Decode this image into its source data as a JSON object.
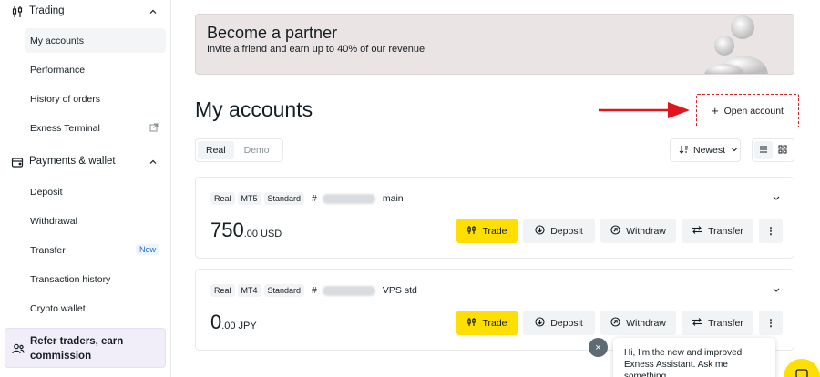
{
  "sidebar": {
    "trading": {
      "label": "Trading",
      "items": [
        {
          "label": "My accounts"
        },
        {
          "label": "Performance"
        },
        {
          "label": "History of orders"
        },
        {
          "label": "Exness Terminal"
        }
      ]
    },
    "payments": {
      "label": "Payments & wallet",
      "items": [
        {
          "label": "Deposit"
        },
        {
          "label": "Withdrawal"
        },
        {
          "label": "Transfer",
          "badge": "New"
        },
        {
          "label": "Transaction history"
        },
        {
          "label": "Crypto wallet"
        }
      ]
    },
    "refer": {
      "label": "Refer traders, earn commission"
    }
  },
  "banner": {
    "title": "Become a partner",
    "subtitle": "Invite a friend and earn up to 40% of our revenue"
  },
  "main": {
    "title": "My accounts",
    "open_account": "Open account",
    "tabs": [
      {
        "label": "Real"
      },
      {
        "label": "Demo"
      }
    ],
    "sort": "Newest"
  },
  "accounts": [
    {
      "tags": [
        "Real",
        "MT5",
        "Standard"
      ],
      "hash": "#",
      "name": "main",
      "balance_int": "750",
      "balance_dec": ".00",
      "currency": "USD",
      "actions": {
        "trade": "Trade",
        "deposit": "Deposit",
        "withdraw": "Withdraw",
        "transfer": "Transfer",
        "more": "⋮"
      }
    },
    {
      "tags": [
        "Real",
        "MT4",
        "Standard"
      ],
      "hash": "#",
      "name": "VPS std",
      "balance_int": "0",
      "balance_dec": ".00",
      "currency": "JPY",
      "actions": {
        "trade": "Trade",
        "deposit": "Deposit",
        "withdraw": "Withdraw",
        "transfer": "Transfer",
        "more": "⋮"
      }
    }
  ],
  "chat": {
    "close": "×",
    "message": "Hi, I'm the new and improved Exness Assistant. Ask me something"
  },
  "colors": {
    "accent": "#ffde02",
    "highlight": "#d8222a",
    "refer_bg": "#f1eef9"
  }
}
